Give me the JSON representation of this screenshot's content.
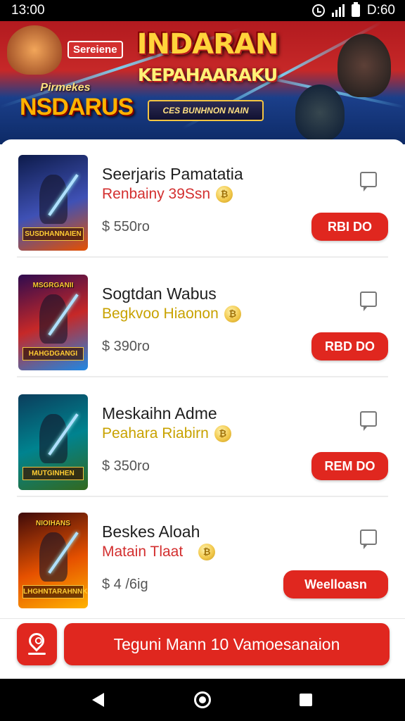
{
  "status_bar": {
    "time": "13:00",
    "right_text": "D:60",
    "icons": [
      "alarm-icon",
      "signal-icon",
      "battery-icon"
    ]
  },
  "banner": {
    "tag": "Sereiene",
    "title": "INDARAN",
    "subtitle": "KEPAHAARAKU",
    "ribbon": "CES BUNHNON NAIN",
    "logo_top": "Pirmekes",
    "logo_main": "NSDARUS"
  },
  "items": [
    {
      "title": "Seerjaris Pamatatia",
      "subtitle": "Renbainy 39Ssn",
      "subtitle_color": "#d32f2f",
      "price": "$ 550ro",
      "button": "RBI DO",
      "thumb_top": "",
      "thumb_caption": "SUSDHANNAIEN",
      "thumb_colors": [
        "#0d1b4a",
        "#3f51b5",
        "#e65100"
      ],
      "coin_icon": "coin-icon"
    },
    {
      "title": "Sogtdan Wabus",
      "subtitle": "Begkvoo Hiaonon",
      "subtitle_color": "#c8a200",
      "price": "$ 390ro",
      "button": "RBD DO",
      "thumb_top": "MSGRGANII",
      "thumb_caption": "HAHGDGANGI",
      "thumb_colors": [
        "#2e0b4f",
        "#c62828",
        "#1e88e5"
      ],
      "coin_icon": "coin-icon"
    },
    {
      "title": "Meskaihn Adme",
      "subtitle": "Peahara Riabirn",
      "subtitle_color": "#c8a200",
      "price": "$ 350ro",
      "button": "REM DO",
      "thumb_top": "",
      "thumb_caption": "MUTGINHEN",
      "thumb_colors": [
        "#0b3d5c",
        "#00838f",
        "#33691e"
      ],
      "coin_icon": "coin-icon"
    },
    {
      "title": "Beskes Aloah",
      "subtitle": "Matain Tlaat",
      "subtitle_color": "#d32f2f",
      "price": "$ 4 /6ig",
      "button": "Weelloasn",
      "thumb_top": "NIOIHANS",
      "thumb_caption": "LHGHNTARAHNNK",
      "thumb_colors": [
        "#3e0a0a",
        "#e65100",
        "#ffb300"
      ],
      "coin_icon": "coin-icon"
    }
  ],
  "bottom_bar": {
    "location_icon": "location-pin-icon",
    "cta_label": "Teguni Mann 10 Vamoesanaion"
  },
  "nav_bar": {
    "icons": [
      "back-icon",
      "home-icon",
      "recents-icon"
    ]
  },
  "colors": {
    "accent": "#e0271f",
    "gold": "#c8a200"
  }
}
